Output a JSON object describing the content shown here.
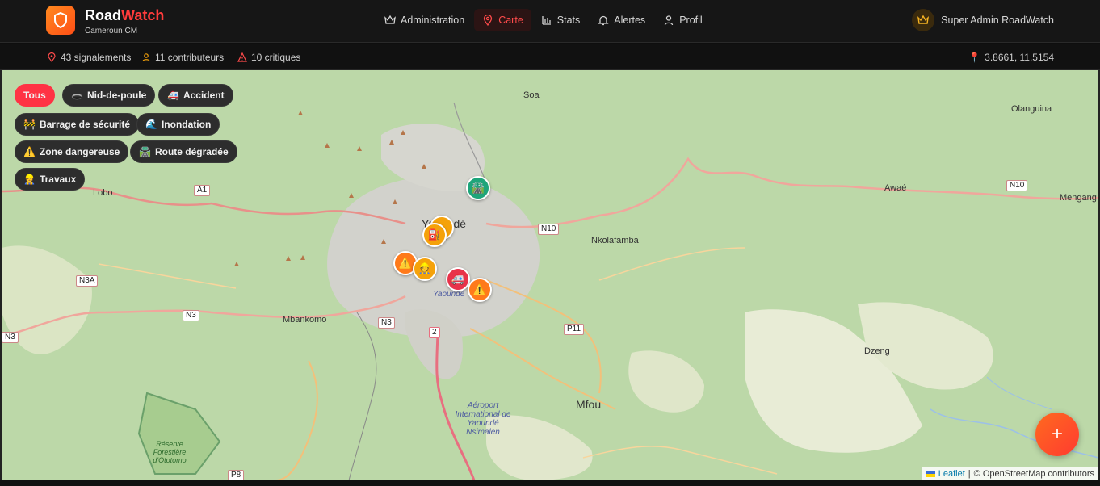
{
  "header": {
    "brand_main": "Road",
    "brand_accent": "Watch",
    "brand_sub": "Cameroun CM",
    "nav": [
      {
        "label": "Administration",
        "icon": "crown-icon"
      },
      {
        "label": "Carte",
        "icon": "map-pin-icon",
        "active": true
      },
      {
        "label": "Stats",
        "icon": "bar-chart-icon"
      },
      {
        "label": "Alertes",
        "icon": "bell-icon"
      },
      {
        "label": "Profil",
        "icon": "user-icon"
      }
    ],
    "user_name": "Super Admin RoadWatch"
  },
  "stats": {
    "reports": "43 signalements",
    "contributors": "11 contributeurs",
    "critical": "10 critiques",
    "coords": "3.8661, 11.5154"
  },
  "filters": [
    {
      "label": "Tous",
      "emoji": "",
      "active": true
    },
    {
      "label": "Nid-de-poule",
      "emoji": "🕳️"
    },
    {
      "label": "Accident",
      "emoji": "🚑"
    },
    {
      "label": "Barrage de sécurité",
      "emoji": "🚧"
    },
    {
      "label": "Inondation",
      "emoji": "🌊"
    },
    {
      "label": "Zone dangereuse",
      "emoji": "⚠️"
    },
    {
      "label": "Route dégradée",
      "emoji": "🛣️"
    },
    {
      "label": "Travaux",
      "emoji": "👷"
    }
  ],
  "map_labels": {
    "soa": "Soa",
    "olanguina": "Olanguina",
    "lobo": "Lobo",
    "awae": "Awaé",
    "mengang": "Mengang",
    "yaounde": "Yaoundé",
    "nkolafamba": "Nkolafamba",
    "mbankomo": "Mbankomo",
    "dzeng": "Dzeng",
    "mfou": "Mfou",
    "airport": "Aéroport International de Yaoundé Nsimalen",
    "reserve": "Réserve Forestière d'Ototomo",
    "yaounde_small": "Yaoundé",
    "road_a1": "A1",
    "road_n10a": "N10",
    "road_n10b": "N10",
    "road_n3a": "N3A",
    "road_n3a2": "N3",
    "road_n3b": "N3",
    "road_n3c": "N3",
    "road_p11": "P11",
    "road_p8": "P8",
    "road_2": "2"
  },
  "attribution": {
    "leaflet": "Leaflet",
    "sep": "|",
    "osm": "© OpenStreetMap contributors"
  },
  "fab_label": "+",
  "colors": {
    "accent": "#ff3344",
    "orange": "#ff7a1a",
    "yellow": "#f5a20a",
    "green": "#1fa57a",
    "red": "#e8334a"
  }
}
